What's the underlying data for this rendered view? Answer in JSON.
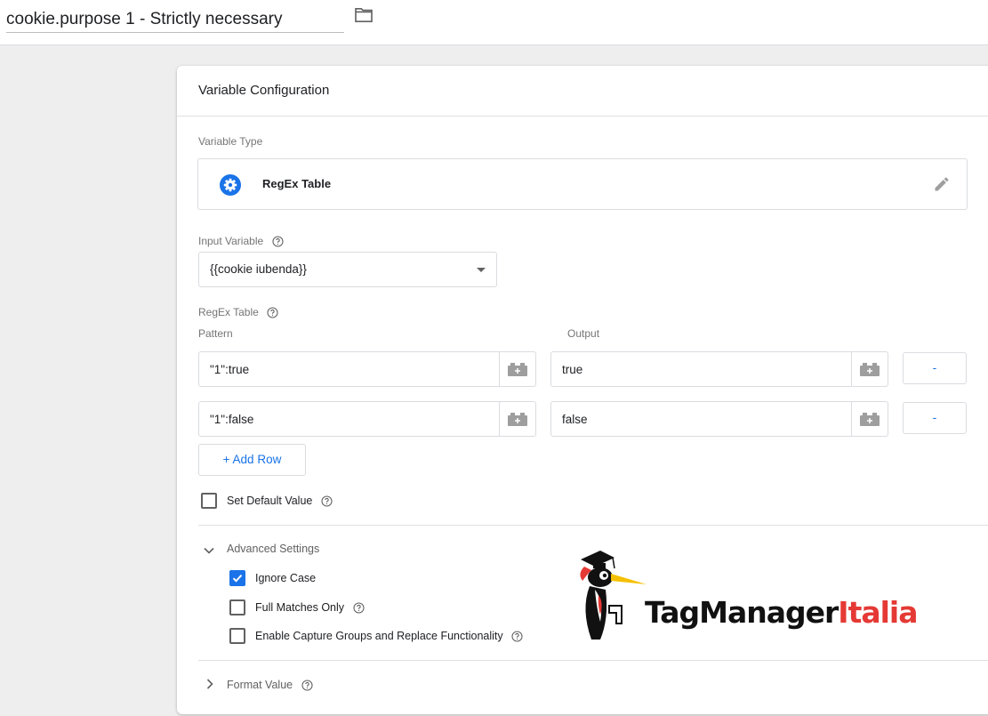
{
  "header": {
    "variable_name": "cookie.purpose 1 - Strictly necessary",
    "folder_icon": "folder-icon"
  },
  "card": {
    "title": "Variable Configuration",
    "variable_type": {
      "label": "Variable Type",
      "name": "RegEx Table",
      "icon": "gear-icon",
      "edit_icon": "pencil-icon"
    },
    "input_variable": {
      "label": "Input Variable",
      "value": "{{cookie iubenda}}"
    },
    "regex_table": {
      "label": "RegEx Table",
      "pattern_header": "Pattern",
      "output_header": "Output",
      "rows": [
        {
          "pattern": "\"1\":true",
          "output": "true",
          "remove_label": "-"
        },
        {
          "pattern": "\"1\":false",
          "output": "false",
          "remove_label": "-"
        }
      ],
      "add_row_label": "+ Add Row"
    },
    "set_default_value": {
      "label": "Set Default Value",
      "checked": false
    },
    "advanced_settings": {
      "title": "Advanced Settings",
      "expanded": true,
      "ignore_case": {
        "label": "Ignore Case",
        "checked": true
      },
      "full_matches_only": {
        "label": "Full Matches Only",
        "checked": false
      },
      "capture_groups": {
        "label": "Enable Capture Groups and Replace Functionality",
        "checked": false
      }
    },
    "format_value": {
      "title": "Format Value",
      "expanded": false
    }
  },
  "watermark": {
    "text_dark": "TagManager",
    "text_red": "Italia"
  },
  "colors": {
    "accent_blue": "#1a73e8",
    "logo_red": "#e53935",
    "border": "#dadce0"
  }
}
